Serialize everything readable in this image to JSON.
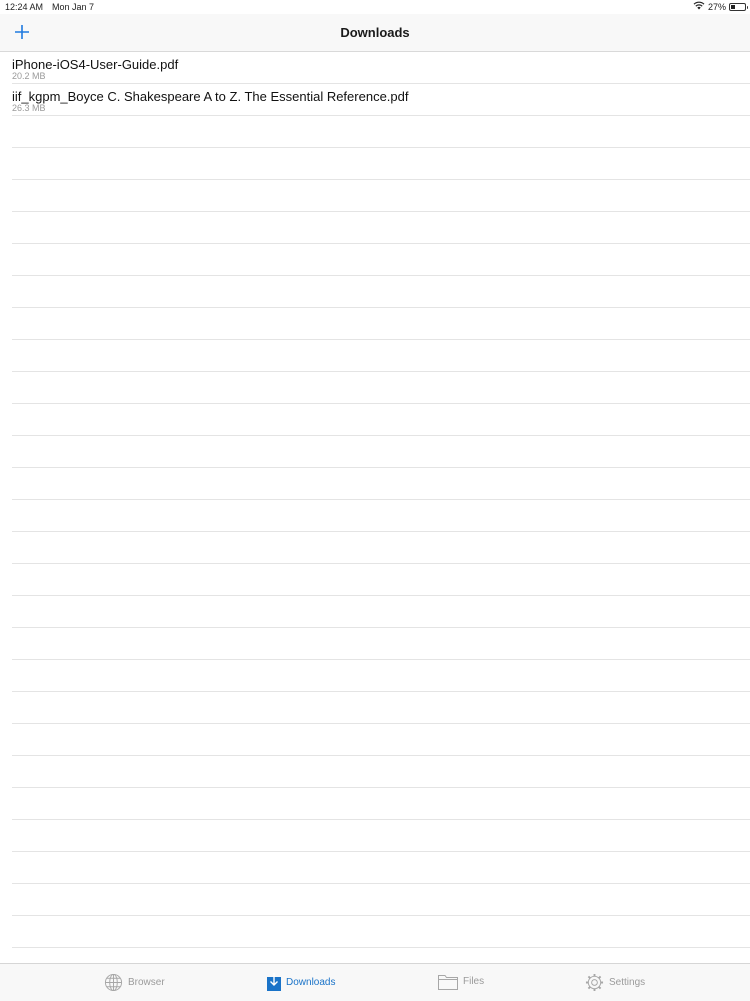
{
  "status_bar": {
    "time": "12:24 AM",
    "date": "Mon Jan 7",
    "battery_percent": "27%",
    "battery_level": 0.27,
    "wifi_icon": "wifi-icon",
    "battery_icon": "battery-icon"
  },
  "nav": {
    "title": "Downloads",
    "add_icon": "plus-icon",
    "accent_color": "#1f7ae0"
  },
  "downloads": [
    {
      "name": "iPhone-iOS4-User-Guide.pdf",
      "size": "20.2 MB"
    },
    {
      "name": "iif_kgpm_Boyce C. Shakespeare A to Z. The Essential Reference.pdf",
      "size": "26.3 MB"
    }
  ],
  "tabs": [
    {
      "label": "Browser",
      "icon": "globe-icon",
      "active": false
    },
    {
      "label": "Downloads",
      "icon": "download-icon",
      "active": true
    },
    {
      "label": "Files",
      "icon": "folder-icon",
      "active": false
    },
    {
      "label": "Settings",
      "icon": "gear-icon",
      "active": false
    }
  ]
}
